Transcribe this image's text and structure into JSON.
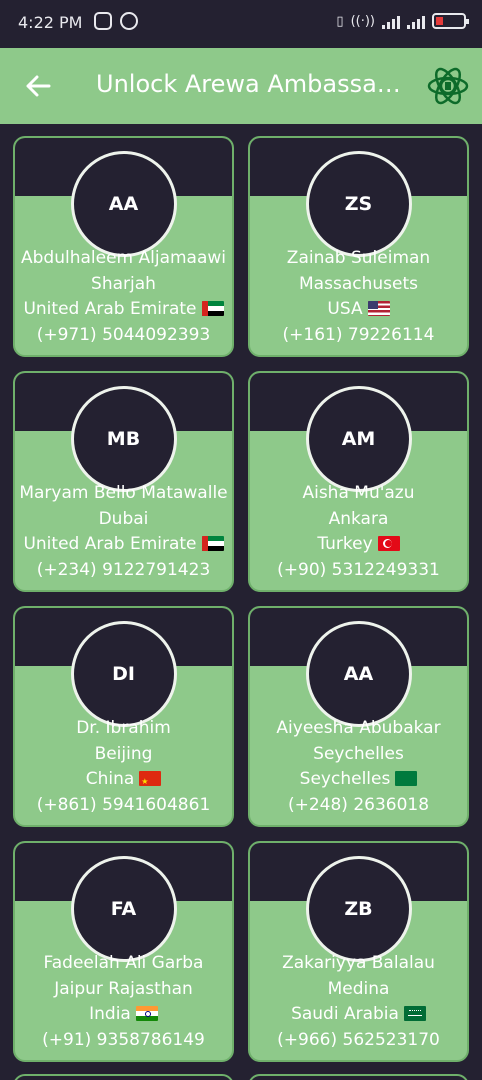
{
  "status_bar": {
    "time": "4:22 PM"
  },
  "app_bar": {
    "title": "Unlock Arewa Ambassadors",
    "back_icon": "arrow-left-icon",
    "logo_icon": "arewa-logo-icon"
  },
  "colors": {
    "accent_green": "#8ec98a",
    "dark_bg": "#242131"
  },
  "ambassadors": [
    {
      "initials": "AA",
      "name": "Abdulhaleem Aljamaawi",
      "city": "Sharjah",
      "country": "United Arab Emirate",
      "flag": "flag-ae",
      "phone": "(+971) 5044092393"
    },
    {
      "initials": "ZS",
      "name": "Zainab Suleiman",
      "city": "Massachusets",
      "country": "USA",
      "flag": "flag-us",
      "phone": "(+161) 79226114"
    },
    {
      "initials": "MB",
      "name": "Maryam Bello Matawalle",
      "city": "Dubai",
      "country": "United Arab Emirate",
      "flag": "flag-ae",
      "phone": "(+234) 9122791423"
    },
    {
      "initials": "AM",
      "name": "Aisha Mu'azu",
      "city": "Ankara",
      "country": "Turkey",
      "flag": "flag-tr",
      "phone": "(+90) 5312249331"
    },
    {
      "initials": "DI",
      "name": "Dr. Ibrahim",
      "city": "Beijing",
      "country": "China",
      "flag": "flag-cn",
      "phone": "(+861) 5941604861"
    },
    {
      "initials": "AA",
      "name": "Aiyeesha Abubakar",
      "city": "Seychelles",
      "country": "Seychelles",
      "flag": "flag-sc",
      "phone": "(+248) 2636018"
    },
    {
      "initials": "FA",
      "name": "Fadeelah Ali Garba",
      "city": "Jaipur Rajasthan",
      "country": "India",
      "flag": "flag-in",
      "phone": "(+91) 9358786149"
    },
    {
      "initials": "ZB",
      "name": "Zakariyya Balalau",
      "city": "Medina",
      "country": "Saudi Arabia",
      "flag": "flag-sa",
      "phone": "(+966) 562523170"
    }
  ]
}
